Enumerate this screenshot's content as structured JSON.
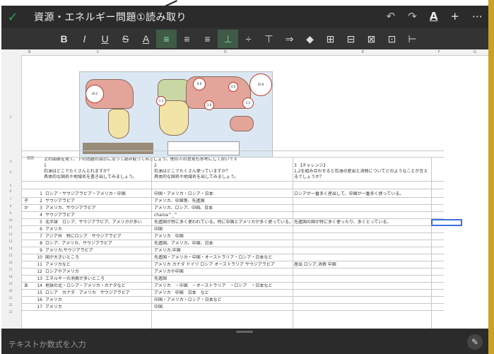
{
  "window": {
    "title": "資源・エネルギー問題①読み取り"
  },
  "toolbar": {
    "buttons": [
      "B",
      "I",
      "U",
      "S",
      "A",
      "≡",
      "≡",
      "≡",
      "⊥",
      "÷",
      "⊤",
      "⇒",
      "◆",
      "⊞",
      "⊟",
      "⊠",
      "⊡",
      "⊢"
    ]
  },
  "sheet": {
    "column_headers": [
      "B",
      "C",
      "D",
      "E",
      "F",
      "G"
    ],
    "row_numbers": [
      "2",
      "3",
      "4",
      "5",
      "6",
      "7",
      "8",
      "9",
      "10",
      "11",
      "12",
      "13",
      "14",
      "15",
      "16",
      "17",
      "18",
      "19",
      "20",
      "21",
      "22",
      "23"
    ],
    "map_label": "名前",
    "instruction": "上の図表を見て、下の問題の指示に沿って読み取ってみましょう。他の人の意見も参考にして良いです",
    "questions": [
      {
        "no": "1",
        "line1": "石油はどこでたくさんとれますか？",
        "line2": "具体的な国名や地域名を書き出してみましょう。"
      },
      {
        "no": "2",
        "line1": "石油はどこでたくさん使っていますか？",
        "line2": "具体的な国名や地域名を出してみましょう。"
      },
      {
        "no": "3 【チャレンジ】",
        "line1": "1,2を組み合わせると石油の産出と消費についてどのようなことが言え",
        "line2": "るでしょうか？"
      }
    ],
    "rows": [
      {
        "label": "",
        "n": "1",
        "a": "ロシア・サウジアラビア・アメリカ・中国",
        "b": "中国・アメリカ・ロシア・日本",
        "c": "ロシアが一番多く産出して、中国が一番多く使っている。"
      },
      {
        "label": "子",
        "n": "2",
        "a": "サウジアラビア",
        "b": "アメリカ、中国等、先進国",
        "c": ""
      },
      {
        "label": "か",
        "n": "3",
        "a": "アメリカ、サウジアラビア",
        "b": "アメリカ、ロシア、中国、日本",
        "c": ""
      },
      {
        "label": "",
        "n": "4",
        "a": "サウジアラビア",
        "b": "chaina^_^",
        "c": ""
      },
      {
        "label": "",
        "n": "5",
        "a": "北半球　ロシア、サウジアラビア、アメリカが多い",
        "b": "先進国が特に多く使われている。特に中国とアメリカが多く使っている。",
        "c": "先進国の国が特に多く使ったり、多くとっている。"
      },
      {
        "label": "",
        "n": "6",
        "a": "アメリカ",
        "b": "中国",
        "c": ""
      },
      {
        "label": "",
        "n": "7",
        "a": "アジア州　特にロシア　サウジアラビア",
        "b": "アメリカ　中国",
        "c": ""
      },
      {
        "label": "",
        "n": "8",
        "a": "ロシア、アメリカ、サウジアラビア",
        "b": "先進国、アメリカ、中国、日本",
        "c": ""
      },
      {
        "label": "",
        "n": "9",
        "a": "アメリカ,サウジアラビア",
        "b": "アメリカ,中国",
        "c": ""
      },
      {
        "label": "",
        "n": "10",
        "a": "国が大きいところ",
        "b": "先進国・アメリカ・中国・オーストラリア・ロシア・日本など",
        "c": ""
      },
      {
        "label": "",
        "n": "11",
        "a": "アメリカなど",
        "b": "アメリカ カナダ ドイツ ロシア オーストラリア サウジアラビア",
        "c": "産出 ロシア,消費 中国"
      },
      {
        "label": "",
        "n": "12",
        "a": "ロシアやアメリカ",
        "b": "アメリカや中国",
        "c": ""
      },
      {
        "label": "",
        "n": "13",
        "a": "エネルギーの消費が多いところ",
        "b": "先進国",
        "c": ""
      },
      {
        "label": "あ",
        "n": "14",
        "a": "地球の北・ロシア・アメリカ・カナダなど",
        "b": "アメリカ　・中国　・オーストラリア　・ロシア　・日本など",
        "c": ""
      },
      {
        "label": "",
        "n": "15",
        "a": "ロシア　カナダ　アメリカ　サウジアラビア",
        "b": "アメリカ　中国　日本　など",
        "c": ""
      },
      {
        "label": "",
        "n": "16",
        "a": "アメリカ",
        "b": "中国・アメリカ・ロシア・日本など",
        "c": ""
      },
      {
        "label": "",
        "n": "17",
        "a": "アメリカ",
        "b": "中国",
        "c": ""
      }
    ]
  },
  "map": {
    "bubbles": [
      "26.2",
      "8.8",
      "26.8",
      "3.8",
      "5.0",
      "2.3",
      "4.6"
    ]
  },
  "input": {
    "placeholder": "テキストか数式を入力"
  },
  "colors": {
    "check": "#2e9e5b",
    "selection": "#3a6fe0",
    "frame_edge": "#c9a227"
  }
}
